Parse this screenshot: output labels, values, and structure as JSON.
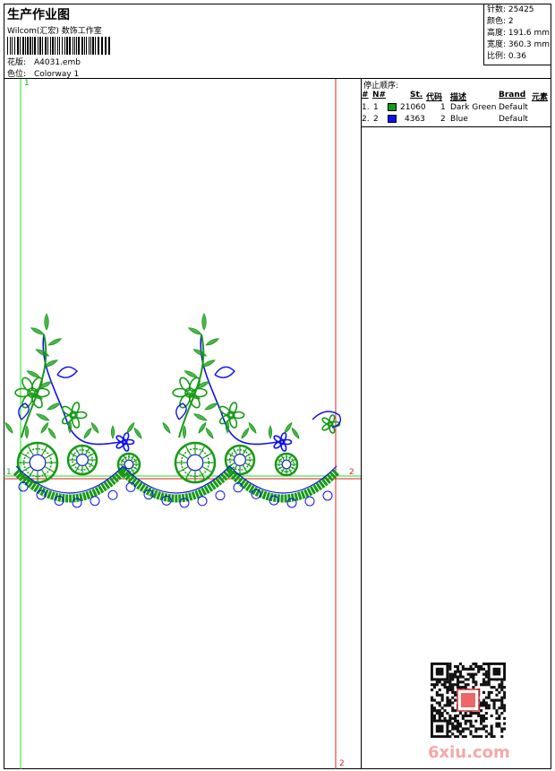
{
  "header": {
    "title": "生产作业图",
    "software": "Wilcom(汇宏) 数饰工作室",
    "design_label": "花版:",
    "design_value": "A4031.emb",
    "colorway_label": "色位:",
    "colorway_value": "Colorway 1"
  },
  "stats": {
    "stitches": "针数: 25425",
    "colors": "颜色: 2",
    "height": "高度: 191.6 mm",
    "width": "宽度: 360.3 mm",
    "scale": "比例: 0.36"
  },
  "guides": {
    "top_left": "1",
    "left_mid": "1",
    "right_mid": "2",
    "bottom_right": "2"
  },
  "stop_sequence": {
    "title": "停止顺序:",
    "headers": [
      "#",
      "N#",
      "St.",
      "代码",
      "描述",
      "Brand",
      "元素"
    ],
    "rows": [
      {
        "idx": "1.",
        "n": "1",
        "st": "21060",
        "code": "1",
        "desc": "Dark Green",
        "brand": "Default",
        "color": "#169a16"
      },
      {
        "idx": "2.",
        "n": "2",
        "st": "4363",
        "code": "2",
        "desc": "Blue",
        "brand": "Default",
        "color": "#1010ee"
      }
    ]
  },
  "watermark": "6xiu.com",
  "colors": {
    "green_thread": "#169a16",
    "blue_thread": "#1010ee",
    "guide_green": "#22dd22",
    "guide_red": "#dd2020"
  }
}
